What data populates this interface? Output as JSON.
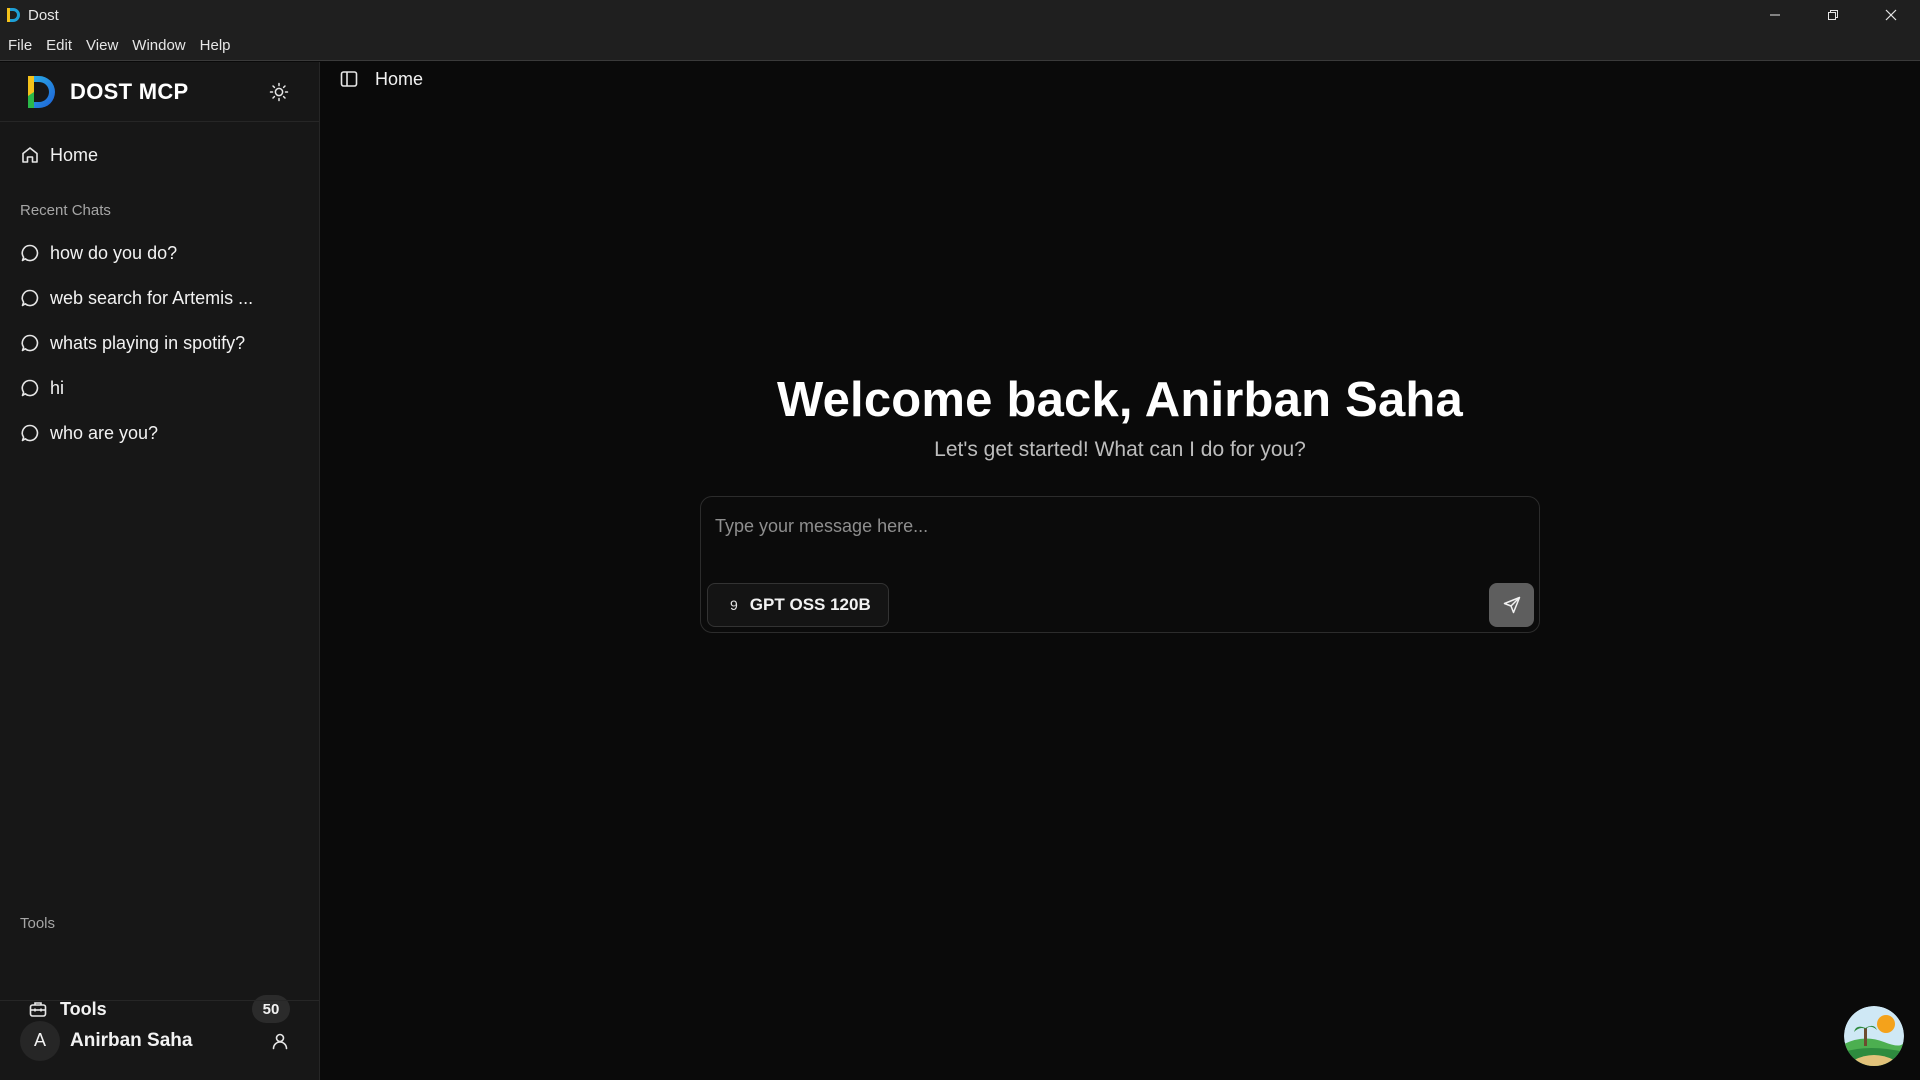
{
  "window": {
    "title": "Dost"
  },
  "menu": [
    "File",
    "Edit",
    "View",
    "Window",
    "Help"
  ],
  "sidebar": {
    "brand": "DOST MCP",
    "home_label": "Home",
    "recent_label": "Recent Chats",
    "recent_chats": [
      "how do you do?",
      "web search for Artemis ...",
      "whats playing in spotify?",
      "hi",
      "who are you?"
    ],
    "tools_section_label": "Tools",
    "tools_label": "Tools",
    "tools_count": "50",
    "user": {
      "initial": "A",
      "name": "Anirban Saha"
    }
  },
  "main": {
    "page_title": "Home",
    "welcome": "Welcome back, Anirban Saha",
    "subtitle": "Let's get started! What can I do for you?",
    "composer": {
      "placeholder": "Type your message here...",
      "model_icon": "9",
      "model_name": "GPT OSS 120B"
    }
  },
  "icons": {
    "theme": "sun-icon",
    "home": "home-icon",
    "chat": "message-circle-icon",
    "tools": "toolbox-icon",
    "user": "user-icon",
    "sidebar_toggle": "panel-left-icon",
    "send": "send-icon"
  },
  "colors": {
    "background": "#0a0a0a",
    "sidebar": "#171717",
    "titlebar": "#1f1f1f",
    "send_button": "#5e5e5e",
    "brand_blue": "#1e7ad6",
    "brand_yellow": "#f4c21b"
  }
}
